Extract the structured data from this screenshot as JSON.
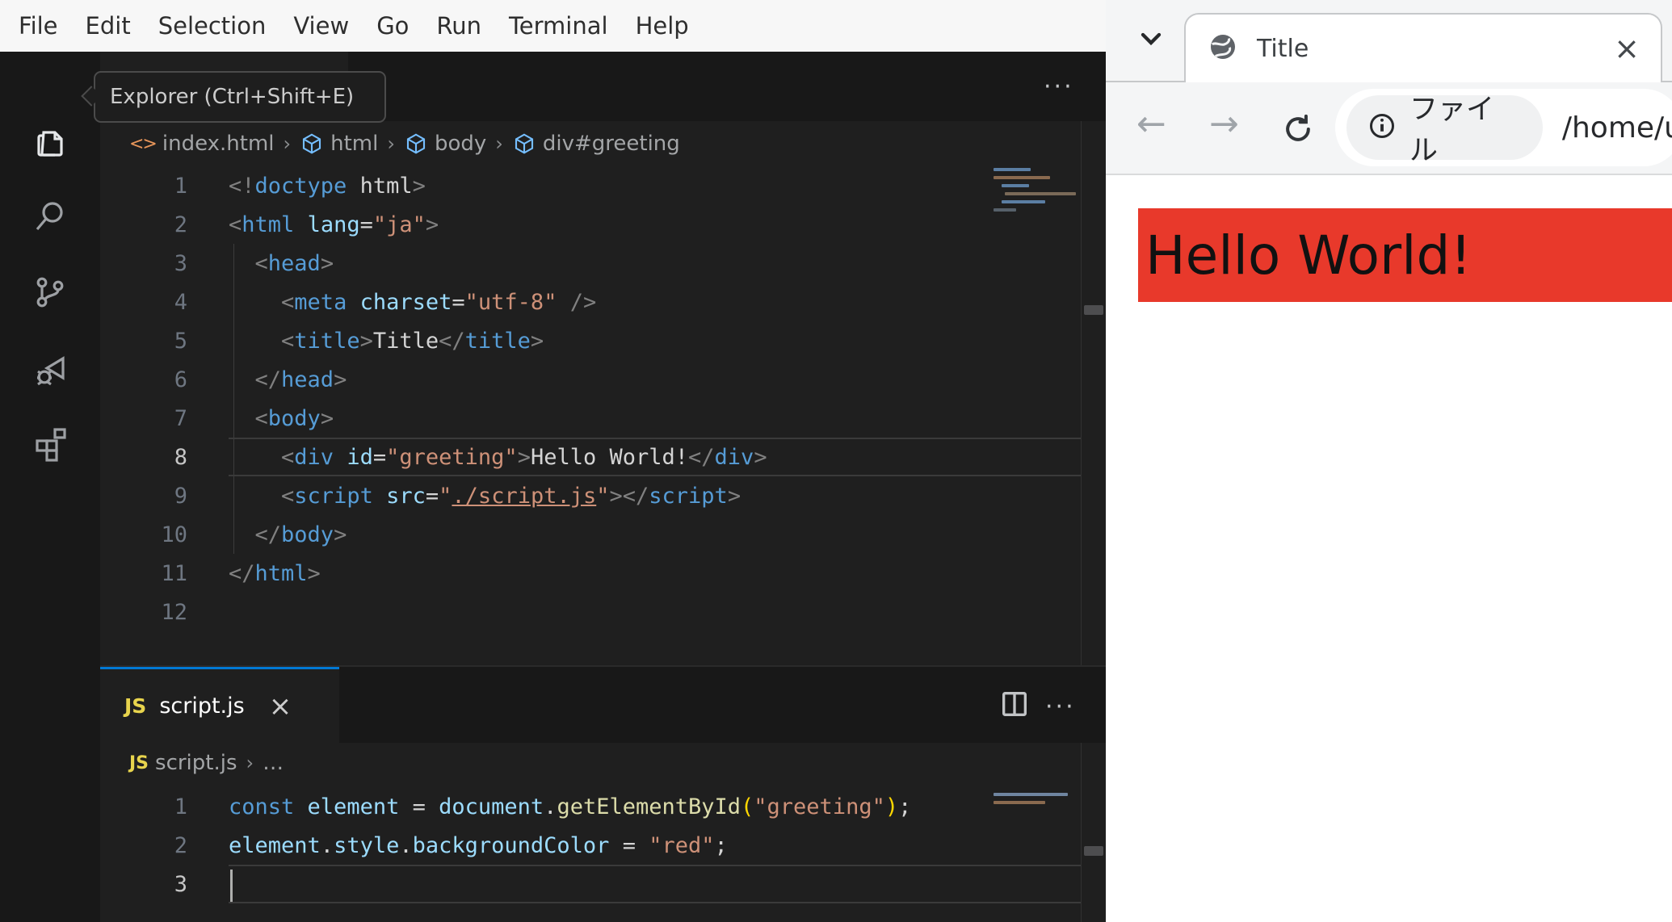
{
  "colors": {
    "accent_blue": "#0078d4",
    "greeting_background_red": "#e8392b",
    "menubar_bg": "#f7f7f7",
    "editor_bg": "#1f1f1f",
    "activitybar_bg": "#181818"
  },
  "vscode": {
    "menu": {
      "items": [
        "File",
        "Edit",
        "Selection",
        "View",
        "Go",
        "Run",
        "Terminal",
        "Help"
      ]
    },
    "tooltip": "Explorer (Ctrl+Shift+E)",
    "activity": [
      "explorer",
      "search",
      "source-control",
      "run-and-debug",
      "extensions"
    ],
    "editor_top": {
      "breadcrumbs": [
        {
          "icon": "code",
          "label": "index.html"
        },
        {
          "icon": "cube",
          "label": "html"
        },
        {
          "icon": "cube",
          "label": "body"
        },
        {
          "icon": "cube",
          "label": "div#greeting"
        }
      ],
      "active_line": 8,
      "lines": [
        {
          "num": "1",
          "tokens": [
            [
              "<!",
              "p"
            ],
            [
              "doctype",
              "tag"
            ],
            [
              " html",
              "fg"
            ],
            [
              ">",
              "p"
            ]
          ]
        },
        {
          "num": "2",
          "tokens": [
            [
              "<",
              "p"
            ],
            [
              "html",
              "tag"
            ],
            [
              " ",
              "fg"
            ],
            [
              "lang",
              "attr"
            ],
            [
              "=",
              "fg"
            ],
            [
              "\"ja\"",
              "str"
            ],
            [
              ">",
              "p"
            ]
          ]
        },
        {
          "num": "3",
          "tokens": [
            [
              "  ",
              "fg"
            ],
            [
              "<",
              "p"
            ],
            [
              "head",
              "tag"
            ],
            [
              ">",
              "p"
            ]
          ]
        },
        {
          "num": "4",
          "tokens": [
            [
              "    ",
              "fg"
            ],
            [
              "<",
              "p"
            ],
            [
              "meta",
              "tag"
            ],
            [
              " ",
              "fg"
            ],
            [
              "charset",
              "attr"
            ],
            [
              "=",
              "fg"
            ],
            [
              "\"utf-8\"",
              "str"
            ],
            [
              " ",
              "fg"
            ],
            [
              "/>",
              "p"
            ]
          ]
        },
        {
          "num": "5",
          "tokens": [
            [
              "    ",
              "fg"
            ],
            [
              "<",
              "p"
            ],
            [
              "title",
              "tag"
            ],
            [
              ">",
              "p"
            ],
            [
              "Title",
              "fg"
            ],
            [
              "</",
              "p"
            ],
            [
              "title",
              "tag"
            ],
            [
              ">",
              "p"
            ]
          ]
        },
        {
          "num": "6",
          "tokens": [
            [
              "  ",
              "fg"
            ],
            [
              "</",
              "p"
            ],
            [
              "head",
              "tag"
            ],
            [
              ">",
              "p"
            ]
          ]
        },
        {
          "num": "7",
          "tokens": [
            [
              "  ",
              "fg"
            ],
            [
              "<",
              "p"
            ],
            [
              "body",
              "tag"
            ],
            [
              ">",
              "p"
            ]
          ]
        },
        {
          "num": "8",
          "tokens": [
            [
              "    ",
              "fg"
            ],
            [
              "<",
              "p"
            ],
            [
              "div",
              "tag"
            ],
            [
              " ",
              "fg"
            ],
            [
              "id",
              "attr"
            ],
            [
              "=",
              "fg"
            ],
            [
              "\"greeting\"",
              "str"
            ],
            [
              ">",
              "p"
            ],
            [
              "Hello World!",
              "fg"
            ],
            [
              "</",
              "p"
            ],
            [
              "div",
              "tag"
            ],
            [
              ">",
              "p"
            ]
          ]
        },
        {
          "num": "9",
          "tokens": [
            [
              "    ",
              "fg"
            ],
            [
              "<",
              "p"
            ],
            [
              "script",
              "tag"
            ],
            [
              " ",
              "fg"
            ],
            [
              "src",
              "attr"
            ],
            [
              "=",
              "fg"
            ],
            [
              "\"",
              "str"
            ],
            [
              "./script.js",
              "link"
            ],
            [
              "\"",
              "str"
            ],
            [
              ">",
              "p"
            ],
            [
              "</",
              "p"
            ],
            [
              "script",
              "tag"
            ],
            [
              ">",
              "p"
            ]
          ]
        },
        {
          "num": "10",
          "tokens": [
            [
              "  ",
              "fg"
            ],
            [
              "</",
              "p"
            ],
            [
              "body",
              "tag"
            ],
            [
              ">",
              "p"
            ]
          ]
        },
        {
          "num": "11",
          "tokens": [
            [
              "</",
              "p"
            ],
            [
              "html",
              "tag"
            ],
            [
              ">",
              "p"
            ]
          ]
        },
        {
          "num": "12",
          "tokens": []
        }
      ]
    },
    "editor_bottom": {
      "tab": {
        "label": "script.js"
      },
      "breadcrumbs": [
        {
          "icon": "js",
          "label": "script.js"
        },
        {
          "icon": "",
          "label": "…"
        }
      ],
      "active_line": 3,
      "lines": [
        {
          "num": "1",
          "tokens": [
            [
              "const",
              "kw"
            ],
            [
              " ",
              "fg"
            ],
            [
              "element",
              "var"
            ],
            [
              " = ",
              "fg"
            ],
            [
              "document",
              "var"
            ],
            [
              ".",
              "fg"
            ],
            [
              "getElementById",
              "fn"
            ],
            [
              "(",
              "paren"
            ],
            [
              "\"greeting\"",
              "str"
            ],
            [
              ")",
              "paren"
            ],
            [
              ";",
              "fg"
            ]
          ]
        },
        {
          "num": "2",
          "tokens": [
            [
              "element",
              "var"
            ],
            [
              ".",
              "fg"
            ],
            [
              "style",
              "var"
            ],
            [
              ".",
              "fg"
            ],
            [
              "backgroundColor",
              "var"
            ],
            [
              " = ",
              "fg"
            ],
            [
              "\"red\"",
              "str"
            ],
            [
              ";",
              "fg"
            ]
          ]
        },
        {
          "num": "3",
          "tokens": []
        }
      ]
    }
  },
  "browser": {
    "tab_title": "Title",
    "chip_label": "ファイル",
    "url": "/home/u",
    "page": {
      "greeting": "Hello World!"
    }
  }
}
